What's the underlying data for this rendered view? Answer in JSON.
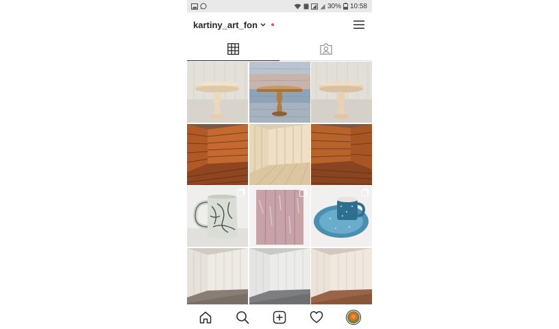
{
  "status_bar": {
    "battery": "30%",
    "time": "10:58",
    "left_icons": [
      "gallery-icon",
      "whatsapp-icon"
    ],
    "right_icons": [
      "wifi-icon",
      "nfc-icon",
      "signal-icon",
      "signal-icon",
      "battery-icon"
    ]
  },
  "header": {
    "username": "kartiny_art_fon",
    "has_notification_dot": true,
    "menu_icon": "hamburger-icon",
    "dot_color": "#ed4956"
  },
  "tabs": [
    {
      "name": "posts-grid",
      "icon": "grid-icon",
      "active": true
    },
    {
      "name": "tagged",
      "icon": "tagged-person-icon",
      "active": false
    }
  ],
  "grid": {
    "posts": [
      {
        "subject": "cake-stand",
        "multi": false
      },
      {
        "subject": "cake-stand-wooden",
        "multi": false
      },
      {
        "subject": "cake-stand",
        "multi": false
      },
      {
        "subject": "corner-backdrop-dark-wood",
        "multi": false
      },
      {
        "subject": "corner-backdrop-light-wood",
        "multi": false
      },
      {
        "subject": "corner-backdrop-dark-wood",
        "multi": false
      },
      {
        "subject": "ceramic-mug",
        "multi": true
      },
      {
        "subject": "pink-wood-board",
        "multi": true
      },
      {
        "subject": "blue-cup-plate",
        "multi": true
      },
      {
        "subject": "corner-backdrop-white-wood",
        "multi": false
      },
      {
        "subject": "corner-backdrop-white-wood",
        "multi": false
      },
      {
        "subject": "corner-backdrop-white-wood",
        "multi": false
      }
    ]
  },
  "bottom_nav": [
    "home-icon",
    "search-icon",
    "new-post-icon",
    "activity-heart-icon",
    "profile-avatar"
  ],
  "colors": {
    "text": "#262626",
    "status_bar_bg": "#e9e9e9",
    "divider": "#dbdbdb"
  }
}
